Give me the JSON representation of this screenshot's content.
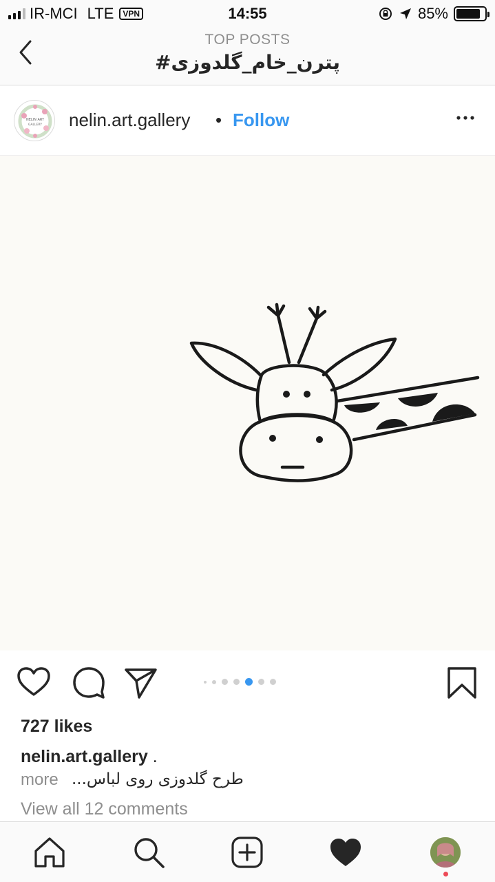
{
  "status_bar": {
    "carrier": "IR-MCI",
    "network": "LTE",
    "vpn": "VPN",
    "time": "14:55",
    "battery": "85%",
    "battery_level": 0.85
  },
  "header": {
    "subtitle": "TOP POSTS",
    "hashtag": "#پترن_خام_گلدوزی"
  },
  "post": {
    "username": "nelin.art.gallery",
    "separator": "•",
    "follow_label": "Follow",
    "avatar_text_line1": "NELIN ART",
    "avatar_text_line2": "GALLERY",
    "carousel": {
      "count": 7,
      "active_index": 4
    },
    "likes": "727 likes",
    "caption_user": "nelin.art.gallery",
    "caption_dot": ".",
    "caption_text": "طرح گلدوزی روی لباس...",
    "caption_more": "more",
    "comments_link": "View all 12 comments"
  },
  "colors": {
    "link_blue": "#3897f0",
    "active_dot": "#3897f0",
    "notification": "#ed4956"
  },
  "icons": {
    "back": "chevron-left-icon",
    "more": "ellipsis-icon",
    "like": "heart-icon",
    "comment": "comment-icon",
    "share": "paper-plane-icon",
    "save": "bookmark-icon",
    "home": "home-icon",
    "search": "search-icon",
    "add": "plus-square-icon",
    "activity": "heart-filled-icon"
  }
}
